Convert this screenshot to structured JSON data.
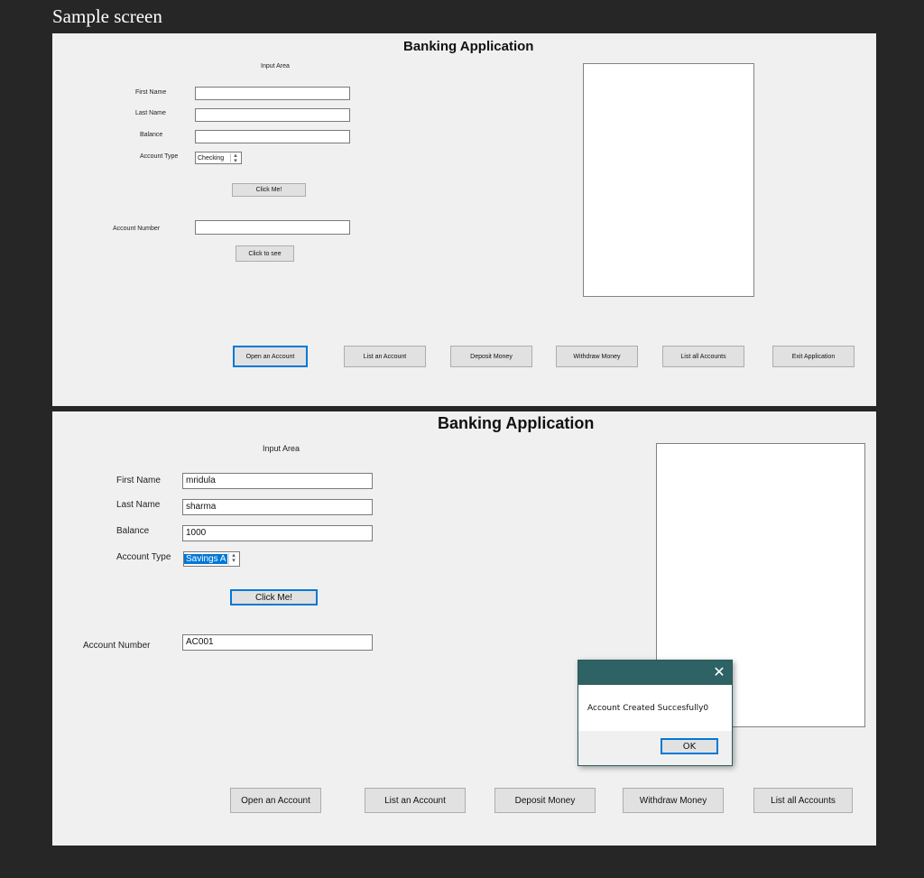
{
  "page": {
    "caption": "Sample screen"
  },
  "screen1": {
    "app_title": "Banking Application",
    "input_area_label": "Input Area",
    "labels": {
      "first_name": "First Name",
      "last_name": "Last Name",
      "balance": "Balance",
      "account_type": "Account Type",
      "account_number": "Account Number"
    },
    "values": {
      "first_name": "",
      "last_name": "",
      "balance": "",
      "account_type": "Checking",
      "account_number": ""
    },
    "click_me": "Click Me!",
    "click_to_see": "Click to see",
    "buttons": [
      "Open an Account",
      "List an Account",
      "Deposit Money",
      "Withdraw Money",
      "List all Accounts",
      "Exit Application"
    ]
  },
  "screen2": {
    "app_title": "Banking Application",
    "input_area_label": "Input Area",
    "labels": {
      "first_name": "First Name",
      "last_name": "Last Name",
      "balance": "Balance",
      "account_type": "Account Type",
      "account_number": "Account Number"
    },
    "values": {
      "first_name": "mridula",
      "last_name": "sharma",
      "balance": "1000",
      "account_type": "Savings A",
      "account_number": "AC001"
    },
    "click_me": "Click Me!",
    "buttons": [
      "Open an Account",
      "List an Account",
      "Deposit Money",
      "Withdraw Money",
      "List all Accounts"
    ],
    "dialog": {
      "message": "Account Created Succesfully0",
      "ok": "OK",
      "close_glyph": "✕"
    }
  },
  "colors": {
    "background": "#262626",
    "form": "#f0f0f0",
    "focus_accent": "#0078d7",
    "dialog_titlebar": "#2e6264"
  }
}
